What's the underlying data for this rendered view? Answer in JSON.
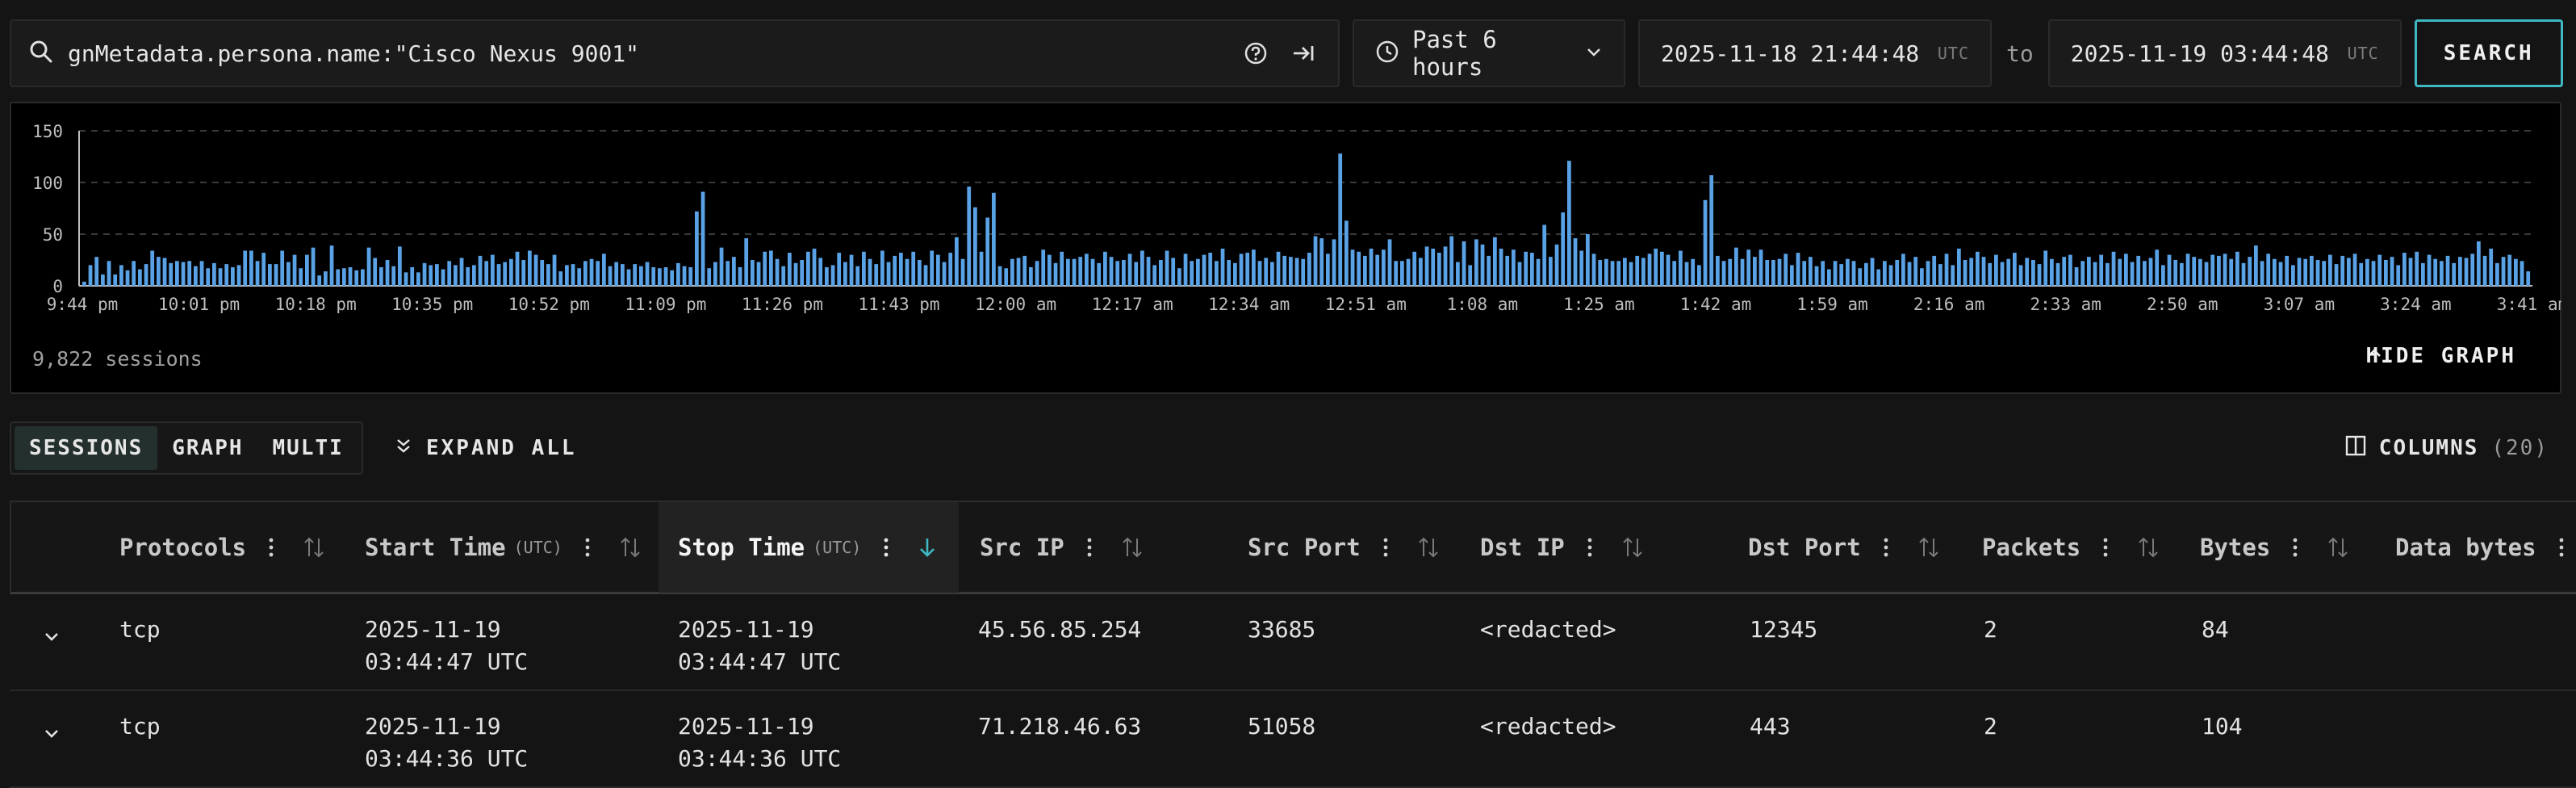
{
  "search": {
    "query": "gnMetadata.persona.name:\"Cisco Nexus 9001\"",
    "time_range": "Past 6 hours",
    "from": "2025-11-18 21:44:48",
    "to_label": "to",
    "to": "2025-11-19 03:44:48",
    "tz": "UTC",
    "button": "SEARCH"
  },
  "chart_data": {
    "type": "bar",
    "ylim": [
      0,
      150
    ],
    "yticks": [
      0,
      50,
      100,
      150
    ],
    "xticks": [
      "9:44 pm",
      "10:01 pm",
      "10:18 pm",
      "10:35 pm",
      "10:52 pm",
      "11:09 pm",
      "11:26 pm",
      "11:43 pm",
      "12:00 am",
      "12:17 am",
      "12:34 am",
      "12:51 am",
      "1:08 am",
      "1:25 am",
      "1:42 am",
      "1:59 am",
      "2:16 am",
      "2:33 am",
      "2:50 am",
      "3:07 am",
      "3:24 am",
      "3:41 am"
    ],
    "grid": true,
    "bar_color": "#5aa2e6",
    "values": [
      4,
      20,
      28,
      11,
      24,
      11,
      20,
      15,
      24,
      16,
      21,
      34,
      28,
      27,
      22,
      24,
      23,
      24,
      19,
      24,
      17,
      22,
      17,
      21,
      18,
      20,
      34,
      34,
      24,
      32,
      21,
      21,
      34,
      23,
      30,
      17,
      30,
      37,
      10,
      14,
      39,
      16,
      17,
      18,
      15,
      16,
      37,
      27,
      18,
      25,
      19,
      38,
      13,
      18,
      13,
      22,
      20,
      21,
      16,
      24,
      20,
      27,
      18,
      20,
      29,
      24,
      30,
      21,
      23,
      26,
      33,
      25,
      34,
      30,
      25,
      21,
      30,
      14,
      20,
      21,
      17,
      24,
      26,
      24,
      31,
      19,
      23,
      21,
      16,
      21,
      19,
      23,
      18,
      17,
      18,
      15,
      22,
      19,
      18,
      72,
      91,
      17,
      23,
      37,
      24,
      28,
      18,
      46,
      25,
      23,
      33,
      34,
      26,
      19,
      32,
      22,
      25,
      33,
      36,
      27,
      18,
      20,
      32,
      23,
      30,
      19,
      33,
      26,
      21,
      34,
      23,
      29,
      32,
      26,
      33,
      25,
      20,
      34,
      30,
      23,
      32,
      47,
      26,
      96,
      76,
      33,
      66,
      90,
      19,
      17,
      26,
      27,
      29,
      18,
      24,
      35,
      30,
      22,
      33,
      26,
      26,
      28,
      31,
      26,
      22,
      33,
      28,
      24,
      25,
      31,
      23,
      34,
      28,
      20,
      25,
      34,
      27,
      17,
      31,
      24,
      26,
      30,
      32,
      24,
      36,
      25,
      22,
      31,
      32,
      35,
      24,
      27,
      23,
      33,
      29,
      28,
      27,
      26,
      32,
      48,
      46,
      31,
      45,
      128,
      63,
      35,
      33,
      29,
      36,
      30,
      35,
      45,
      24,
      24,
      26,
      33,
      27,
      38,
      36,
      32,
      38,
      48,
      23,
      43,
      20,
      45,
      40,
      29,
      47,
      36,
      29,
      35,
      23,
      33,
      32,
      26,
      59,
      28,
      40,
      71,
      121,
      46,
      34,
      50,
      31,
      25,
      26,
      24,
      24,
      27,
      23,
      29,
      27,
      31,
      36,
      33,
      30,
      24,
      34,
      23,
      26,
      20,
      83,
      107,
      29,
      24,
      26,
      37,
      26,
      35,
      28,
      35,
      25,
      25,
      26,
      31,
      20,
      32,
      24,
      28,
      19,
      24,
      16,
      24,
      21,
      26,
      24,
      17,
      22,
      27,
      16,
      24,
      20,
      25,
      31,
      23,
      28,
      17,
      24,
      29,
      21,
      31,
      20,
      36,
      25,
      27,
      33,
      28,
      22,
      30,
      23,
      26,
      32,
      20,
      27,
      25,
      21,
      34,
      26,
      22,
      28,
      30,
      18,
      24,
      28,
      23,
      30,
      22,
      33,
      26,
      31,
      23,
      29,
      24,
      27,
      35,
      20,
      30,
      25,
      22,
      31,
      28,
      26,
      23,
      30,
      29,
      31,
      26,
      33,
      22,
      28,
      39,
      24,
      31,
      26,
      23,
      29,
      20,
      27,
      26,
      29,
      25,
      24,
      30,
      21,
      29,
      27,
      31,
      22,
      26,
      24,
      30,
      25,
      28,
      20,
      32,
      27,
      33,
      22,
      30,
      26,
      24,
      29,
      22,
      28,
      27,
      31,
      43,
      29,
      36,
      22,
      28,
      30,
      26,
      24,
      14
    ],
    "summary": "9,822 sessions"
  },
  "graph_toggle": "HIDE GRAPH",
  "views": [
    "SESSIONS",
    "GRAPH",
    "MULTI"
  ],
  "expand_all": "EXPAND ALL",
  "columns": {
    "label": "COLUMNS",
    "count": "(20)"
  },
  "table": {
    "headers": [
      {
        "label": "Protocols"
      },
      {
        "label": "Start Time",
        "utc": "(UTC)"
      },
      {
        "label": "Stop Time",
        "utc": "(UTC)"
      },
      {
        "label": "Src IP"
      },
      {
        "label": "Src Port"
      },
      {
        "label": "Dst IP"
      },
      {
        "label": "Dst Port"
      },
      {
        "label": "Packets"
      },
      {
        "label": "Bytes"
      },
      {
        "label": "Data bytes"
      }
    ],
    "rows": [
      {
        "protocol": "tcp",
        "start_date": "2025-11-19",
        "start_time": "03:44:47 UTC",
        "stop_date": "2025-11-19",
        "stop_time": "03:44:47 UTC",
        "src_ip": "45.56.85.254",
        "src_port": "33685",
        "dst_ip": "<redacted>",
        "dst_port": "12345",
        "packets": "2",
        "bytes": "84"
      },
      {
        "protocol": "tcp",
        "start_date": "2025-11-19",
        "start_time": "03:44:36 UTC",
        "stop_date": "2025-11-19",
        "stop_time": "03:44:36 UTC",
        "src_ip": "71.218.46.63",
        "src_port": "51058",
        "dst_ip": "<redacted>",
        "dst_port": "443",
        "packets": "2",
        "bytes": "104"
      }
    ]
  }
}
